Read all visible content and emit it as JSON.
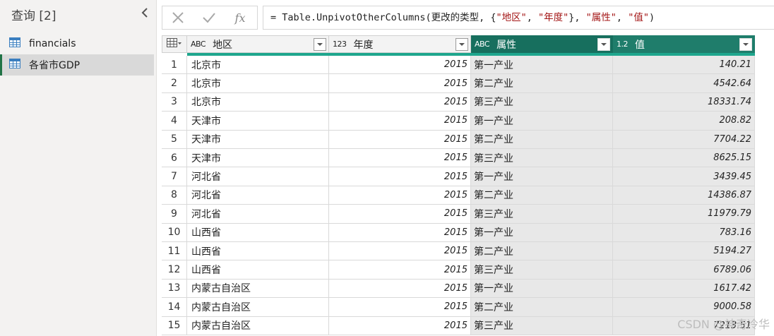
{
  "queries": {
    "title": "查询 [2]",
    "items": [
      {
        "label": "financials",
        "selected": false
      },
      {
        "label": "各省市GDP",
        "selected": true
      }
    ]
  },
  "formula": {
    "prefix": "= Table.UnpivotOtherColumns(更改的类型, {",
    "s1": "\"地区\"",
    "sep1": ", ",
    "s2": "\"年度\"",
    "sep2": "}, ",
    "s3": "\"属性\"",
    "sep3": ", ",
    "s4": "\"值\"",
    "suffix": ")"
  },
  "columns": [
    {
      "type_icon": "ABC",
      "label": "地区"
    },
    {
      "type_icon": "123",
      "label": "年度"
    },
    {
      "type_icon": "ABC",
      "label": "属性"
    },
    {
      "type_icon": "1.2",
      "label": "值"
    }
  ],
  "rows": [
    {
      "n": "1",
      "region": "北京市",
      "year": "2015",
      "attr": "第一产业",
      "value": "140.21"
    },
    {
      "n": "2",
      "region": "北京市",
      "year": "2015",
      "attr": "第二产业",
      "value": "4542.64"
    },
    {
      "n": "3",
      "region": "北京市",
      "year": "2015",
      "attr": "第三产业",
      "value": "18331.74"
    },
    {
      "n": "4",
      "region": "天津市",
      "year": "2015",
      "attr": "第一产业",
      "value": "208.82"
    },
    {
      "n": "5",
      "region": "天津市",
      "year": "2015",
      "attr": "第二产业",
      "value": "7704.22"
    },
    {
      "n": "6",
      "region": "天津市",
      "year": "2015",
      "attr": "第三产业",
      "value": "8625.15"
    },
    {
      "n": "7",
      "region": "河北省",
      "year": "2015",
      "attr": "第一产业",
      "value": "3439.45"
    },
    {
      "n": "8",
      "region": "河北省",
      "year": "2015",
      "attr": "第二产业",
      "value": "14386.87"
    },
    {
      "n": "9",
      "region": "河北省",
      "year": "2015",
      "attr": "第三产业",
      "value": "11979.79"
    },
    {
      "n": "10",
      "region": "山西省",
      "year": "2015",
      "attr": "第一产业",
      "value": "783.16"
    },
    {
      "n": "11",
      "region": "山西省",
      "year": "2015",
      "attr": "第二产业",
      "value": "5194.27"
    },
    {
      "n": "12",
      "region": "山西省",
      "year": "2015",
      "attr": "第三产业",
      "value": "6789.06"
    },
    {
      "n": "13",
      "region": "内蒙古自治区",
      "year": "2015",
      "attr": "第一产业",
      "value": "1617.42"
    },
    {
      "n": "14",
      "region": "内蒙古自治区",
      "year": "2015",
      "attr": "第二产业",
      "value": "9000.58"
    },
    {
      "n": "15",
      "region": "内蒙古自治区",
      "year": "2015",
      "attr": "第三产业",
      "value": "7213.51"
    }
  ],
  "watermark": "CSDN @神奇冷华",
  "colors": {
    "accent": "#217346",
    "selected_header": "#176f5e",
    "stripe": "#1ea68d"
  },
  "icons": [
    "table-icon",
    "collapse-chevron-icon",
    "cancel-x-icon",
    "commit-check-icon",
    "fx-icon",
    "column-type-icon",
    "dropdown-arrow-icon"
  ]
}
